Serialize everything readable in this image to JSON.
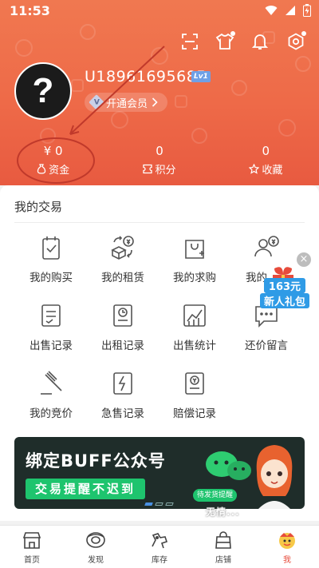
{
  "status_bar": {
    "time": "11:53",
    "icons": [
      "wifi-icon",
      "signal-icon",
      "battery-icon"
    ]
  },
  "header": {
    "top_icons": [
      "scan-icon",
      "clothing-icon",
      "notification-bell-icon",
      "settings-gear-icon"
    ],
    "avatar_glyph": "?",
    "username": "U18961695685",
    "level_badge": "Lv1",
    "vip_button_label": "开通会员",
    "vip_badge": "V"
  },
  "stats": [
    {
      "value": "¥ 0",
      "label": "资金",
      "icon": "money-bag-icon"
    },
    {
      "value": "0",
      "label": "积分",
      "icon": "ticket-icon"
    },
    {
      "value": "0",
      "label": "收藏",
      "icon": "star-icon"
    }
  ],
  "trades": {
    "title": "我的交易",
    "items": [
      {
        "label": "我的购买",
        "icon": "purchase-clipboard-icon"
      },
      {
        "label": "我的租赁",
        "icon": "rental-exchange-icon"
      },
      {
        "label": "我的求购",
        "icon": "wanted-bag-icon"
      },
      {
        "label": "我的",
        "icon": "user-yen-icon"
      },
      {
        "label": "出售记录",
        "icon": "sales-record-icon"
      },
      {
        "label": "出租记录",
        "icon": "rent-record-icon"
      },
      {
        "label": "出售统计",
        "icon": "sales-chart-icon"
      },
      {
        "label": "还价留言",
        "icon": "message-icon"
      },
      {
        "label": "我的竞价",
        "icon": "auction-gavel-icon"
      },
      {
        "label": "急售记录",
        "icon": "quick-sale-icon"
      },
      {
        "label": "赔偿记录",
        "icon": "compensation-icon"
      }
    ]
  },
  "gift_popup": {
    "amount": "163元",
    "text": "新人礼包",
    "close_glyph": "×"
  },
  "banner": {
    "title": "绑定BUFF公众号",
    "subtitle": "交易提醒不迟到",
    "tag": "待发货提醒"
  },
  "watermark": "无情...",
  "tabbar": {
    "active_index": 4,
    "accent_color": "#e74c3c",
    "tabs": [
      {
        "label": "首页",
        "icon": "home-shop-icon"
      },
      {
        "label": "发现",
        "icon": "discover-icon"
      },
      {
        "label": "库存",
        "icon": "inventory-icon"
      },
      {
        "label": "店铺",
        "icon": "store-bag-icon"
      },
      {
        "label": "我",
        "icon": "me-avatar-icon"
      }
    ]
  },
  "colors": {
    "header_gradient_top": "#f07850",
    "header_gradient_bottom": "#e85a40",
    "annotation": "#c0392b",
    "banner_green": "#1ec46e"
  }
}
